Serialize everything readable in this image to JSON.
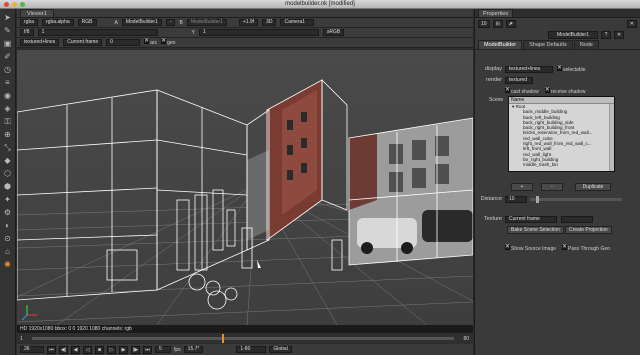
{
  "window": {
    "title": "modelbuilder.nk [modified]"
  },
  "toolbar": {
    "icons": [
      "pointer-icon",
      "paint-icon",
      "image-icon",
      "draw-icon",
      "time-icon",
      "channel-icon",
      "color-icon",
      "filter-icon",
      "keyer-icon",
      "merge-icon",
      "transform-icon",
      "3d-icon",
      "views-icon",
      "metadata-icon",
      "toolsets-icon",
      "other-icon",
      "furnace-icon",
      "ocula-icon",
      "plugin-icon",
      "nuke-icon"
    ]
  },
  "viewer": {
    "tab": "Viewer1",
    "row1": {
      "channels": "rgba",
      "alpha": "rgba.alpha",
      "display": "RGB",
      "a_label": "A",
      "a_input": "ModelBuilder1",
      "dash": "-",
      "b_label": "B",
      "b_input": "ModelBuilder1",
      "zoom": "+1.9f",
      "view_mode": "3D",
      "camera": "Camera1"
    },
    "row2": {
      "fstop": "f/8",
      "gain": "1",
      "y_label": "Y",
      "gamma": "1",
      "lut": "sRGB"
    },
    "row3": {
      "render_mode": "textured+lines",
      "frame_mode": "Current frame",
      "frame_value": "0",
      "arc_label": "arc",
      "geo_label": "geo"
    },
    "info": "HD 1920x1080 bbox: 0 0 1920 1080 channels: rgb",
    "timeline": {
      "start": "1",
      "frame": "36",
      "step": "5",
      "fps_label": "fps",
      "fps": "15.7*",
      "range": "1-80",
      "global": "Global",
      "end": "80"
    }
  },
  "properties": {
    "title": "Properties",
    "count": "10",
    "node_name": "ModelBuilder1",
    "tabs": [
      "ModelBuilder",
      "Shape Defaults",
      "Node"
    ],
    "display_label": "display",
    "display_value": "textured+lines",
    "selectable_label": "selectable",
    "render_label": "render",
    "render_value": "textured",
    "cast_shadow_label": "cast shadow",
    "receive_shadow_label": "receive shadow",
    "scene_label": "Scene",
    "scene_header": "Name",
    "scene_root": "Root",
    "scene_items": [
      "back_middle_building",
      "back_left_building",
      "back_right_building_side",
      "back_right_building_front",
      "bricks_extension_from_red_wall...",
      "red_wall_cube",
      "right_red_wall_from_red_wall_c...",
      "left_front_wall",
      "red_wall_light",
      "far_right_building",
      "middle_trash_bin"
    ],
    "add_label": "+",
    "remove_label": "-",
    "duplicate_label": "Duplicate",
    "distance_label": "Distance",
    "distance_value": "10",
    "texture_label": "Texture",
    "texture_value": "Current frame",
    "bake_label": "Bake Scene Selection",
    "create_projection_label": "Create Projection",
    "show_source_label": "Show Source Image",
    "pass_through_label": "Pass Through Geo"
  },
  "colors": {
    "accent": "#e8902a",
    "wire": "#ffffff",
    "panel": "#3a3a3a"
  }
}
